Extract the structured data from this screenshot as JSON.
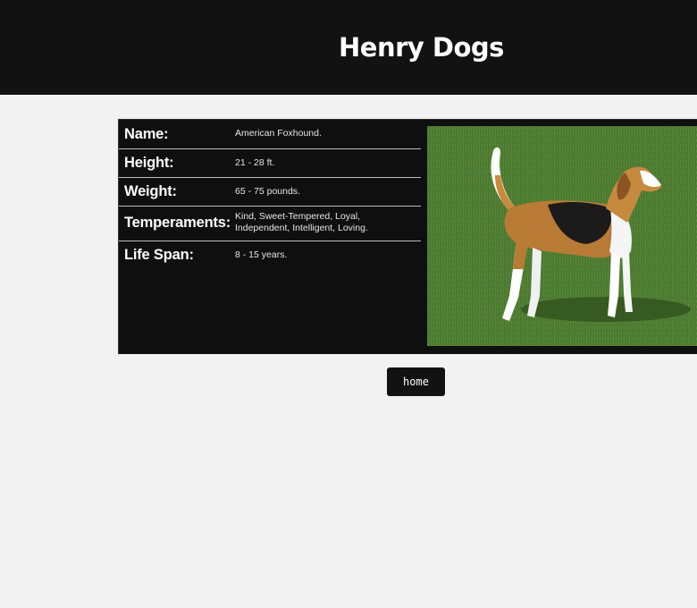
{
  "header": {
    "title": "Henry Dogs"
  },
  "breed_info": [
    {
      "label": "Name:",
      "value": "American Foxhound."
    },
    {
      "label": "Height:",
      "value": "21 - 28 ft."
    },
    {
      "label": "Weight:",
      "value": "65 - 75 pounds."
    },
    {
      "label": "Temperaments:",
      "value": "Kind, Sweet-Tempered, Loyal, Independent, Intelligent, Loving."
    },
    {
      "label": "Life Span:",
      "value": "8 - 15 years."
    }
  ],
  "photo": {
    "subject": "American Foxhound standing on grass"
  },
  "nav": {
    "home_label": "home"
  },
  "colors": {
    "header_bg": "#121212",
    "page_bg": "#f2f2f2",
    "card_bg": "#0f0f0f",
    "grass": "#4c7a31"
  }
}
